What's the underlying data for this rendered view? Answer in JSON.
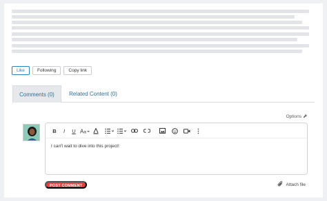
{
  "actions": {
    "like_label": "Like",
    "following_label": "Following",
    "copy_link_label": "Copy link"
  },
  "tabs": [
    {
      "label": "Comments (0)"
    },
    {
      "label": "Related Content (0)"
    }
  ],
  "options_label": "Options",
  "toolbar": {
    "icons": [
      "bold-icon",
      "italic-icon",
      "underline-icon",
      "font-size-icon",
      "text-color-icon",
      "numbered-list-icon",
      "bulleted-list-icon",
      "link-icon",
      "unlink-icon",
      "image-icon",
      "emoji-icon",
      "video-icon",
      "more-icon"
    ]
  },
  "editor": {
    "content": "I can't wait to dive into this project!"
  },
  "post_comment_label": "POST COMMENT",
  "attach_file_label": "Attach file",
  "colors": {
    "accent": "#2d7fb8",
    "post_button": "#e34040",
    "skeleton": "#e3e4e8"
  }
}
